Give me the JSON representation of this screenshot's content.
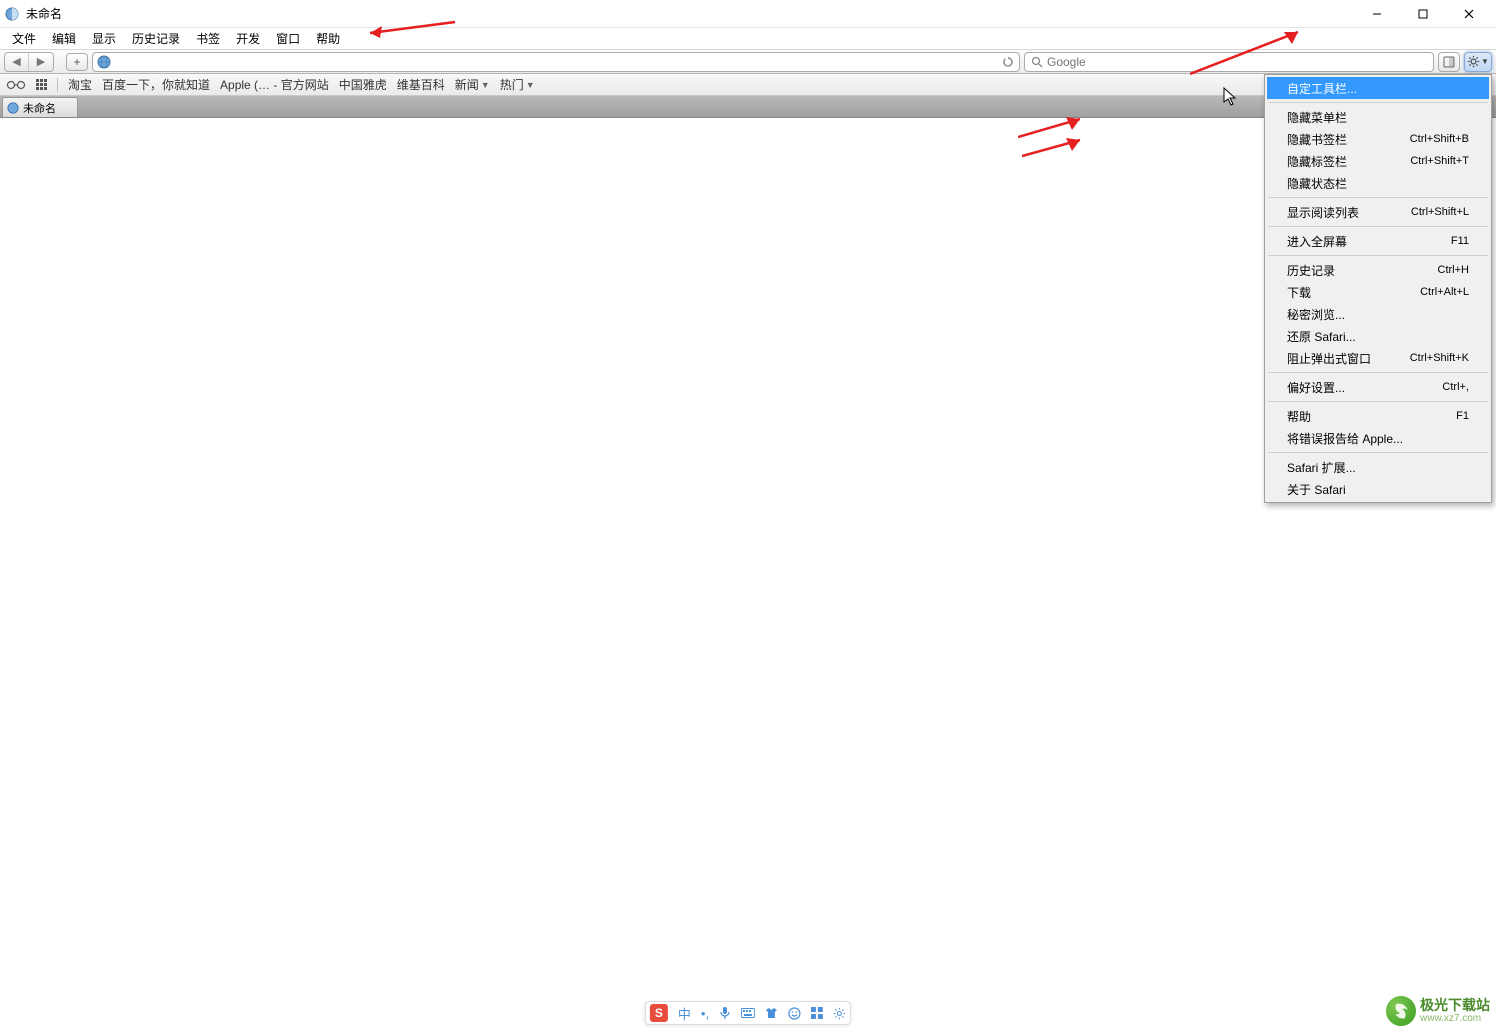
{
  "window": {
    "title": "未命名"
  },
  "menubar": [
    "文件",
    "编辑",
    "显示",
    "历史记录",
    "书签",
    "开发",
    "窗口",
    "帮助"
  ],
  "toolbar": {
    "url_value": "",
    "search_placeholder": "Google"
  },
  "bookmarks": [
    "淘宝",
    "百度一下，你就知道",
    "Apple (… - 官方网站",
    "中国雅虎",
    "维基百科",
    "新闻",
    "热门"
  ],
  "tab": {
    "title": "未命名"
  },
  "dropdown": {
    "items": [
      {
        "label": "自定工具栏...",
        "shortcut": "",
        "highlight": true
      },
      {
        "sep": true
      },
      {
        "label": "隐藏菜单栏",
        "shortcut": ""
      },
      {
        "label": "隐藏书签栏",
        "shortcut": "Ctrl+Shift+B"
      },
      {
        "label": "隐藏标签栏",
        "shortcut": "Ctrl+Shift+T"
      },
      {
        "label": "隐藏状态栏",
        "shortcut": ""
      },
      {
        "sep": true
      },
      {
        "label": "显示阅读列表",
        "shortcut": "Ctrl+Shift+L"
      },
      {
        "sep": true
      },
      {
        "label": "进入全屏幕",
        "shortcut": "F11"
      },
      {
        "sep": true
      },
      {
        "label": "历史记录",
        "shortcut": "Ctrl+H"
      },
      {
        "label": "下载",
        "shortcut": "Ctrl+Alt+L"
      },
      {
        "label": "秘密浏览...",
        "shortcut": ""
      },
      {
        "label": "还原 Safari...",
        "shortcut": ""
      },
      {
        "label": "阻止弹出式窗口",
        "shortcut": "Ctrl+Shift+K"
      },
      {
        "sep": true
      },
      {
        "label": "偏好设置...",
        "shortcut": "Ctrl+,"
      },
      {
        "sep": true
      },
      {
        "label": "帮助",
        "shortcut": "F1"
      },
      {
        "label": "将错误报告给 Apple...",
        "shortcut": ""
      },
      {
        "sep": true
      },
      {
        "label": "Safari 扩展...",
        "shortcut": ""
      },
      {
        "label": "关于 Safari",
        "shortcut": ""
      }
    ]
  },
  "ime": {
    "logo": "S",
    "lang": "中",
    "icons": [
      "punct",
      "mic",
      "keyboard",
      "shirt",
      "face",
      "grid",
      "gear"
    ]
  },
  "watermark": {
    "cn": "极光下载站",
    "url": "www.xz7.com"
  }
}
